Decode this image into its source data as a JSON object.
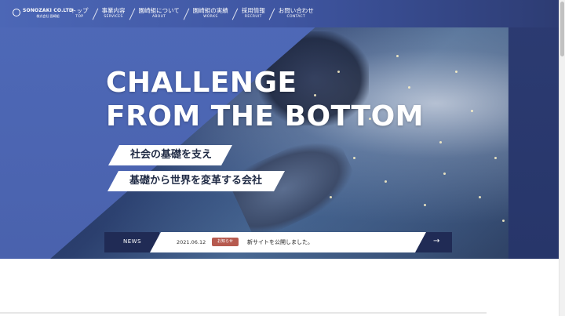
{
  "colors": {
    "brand_blue": "#4e69b8",
    "navy": "#202b55",
    "badge_red": "#b65a4f"
  },
  "logo": {
    "name": "SONOZAKI CO.LTD",
    "sub": "株式会社 園崎組",
    "icon": "circle-logo-icon"
  },
  "nav": [
    {
      "jp": "トップ",
      "en": "TOP"
    },
    {
      "jp": "事業内容",
      "en": "SERVICES"
    },
    {
      "jp": "園崎組について",
      "en": "ABOUT"
    },
    {
      "jp": "園崎組の実績",
      "en": "WORKS"
    },
    {
      "jp": "採用情報",
      "en": "RECRUIT"
    },
    {
      "jp": "お問い合わせ",
      "en": "CONTACT"
    }
  ],
  "hero": {
    "headline_line1": "CHALLENGE",
    "headline_line2": "FROM THE BOTTOM",
    "tagline1": "社会の基礎を支え",
    "tagline2": "基礎から世界を変革する会社"
  },
  "news": {
    "label": "NEWS",
    "date": "2021.06.12",
    "badge": "お知らせ",
    "title": "新サイトを公開しました。",
    "arrow_icon": "arrow-right-icon",
    "arrow": "→"
  }
}
